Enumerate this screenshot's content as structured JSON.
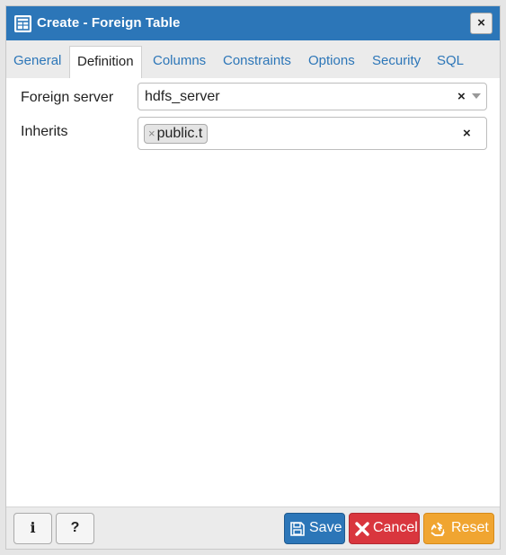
{
  "dialog": {
    "title": "Create - Foreign Table",
    "close_label": "×"
  },
  "tabs": [
    {
      "label": "General",
      "active": false
    },
    {
      "label": "Definition",
      "active": true
    },
    {
      "label": "Columns",
      "active": false
    },
    {
      "label": "Constraints",
      "active": false
    },
    {
      "label": "Options",
      "active": false
    },
    {
      "label": "Security",
      "active": false
    },
    {
      "label": "SQL",
      "active": false
    }
  ],
  "form": {
    "foreign_server": {
      "label": "Foreign server",
      "value": "hdfs_server",
      "clear": "×"
    },
    "inherits": {
      "label": "Inherits",
      "tags": [
        "public.t"
      ],
      "tag_remove": "×",
      "clear": "×"
    }
  },
  "footer": {
    "info_label": "i",
    "help_label": "?",
    "save_label": "Save",
    "cancel_label": "Cancel",
    "reset_label": "Reset"
  },
  "colors": {
    "titlebar": "#2c76b8",
    "accent": "#2c76b8",
    "save": "#2c76b8",
    "cancel": "#d9363e",
    "reset": "#f0a531"
  },
  "icons": {
    "title": "table-icon",
    "save": "floppy-disk-icon",
    "cancel": "x-icon",
    "reset": "recycle-icon"
  }
}
